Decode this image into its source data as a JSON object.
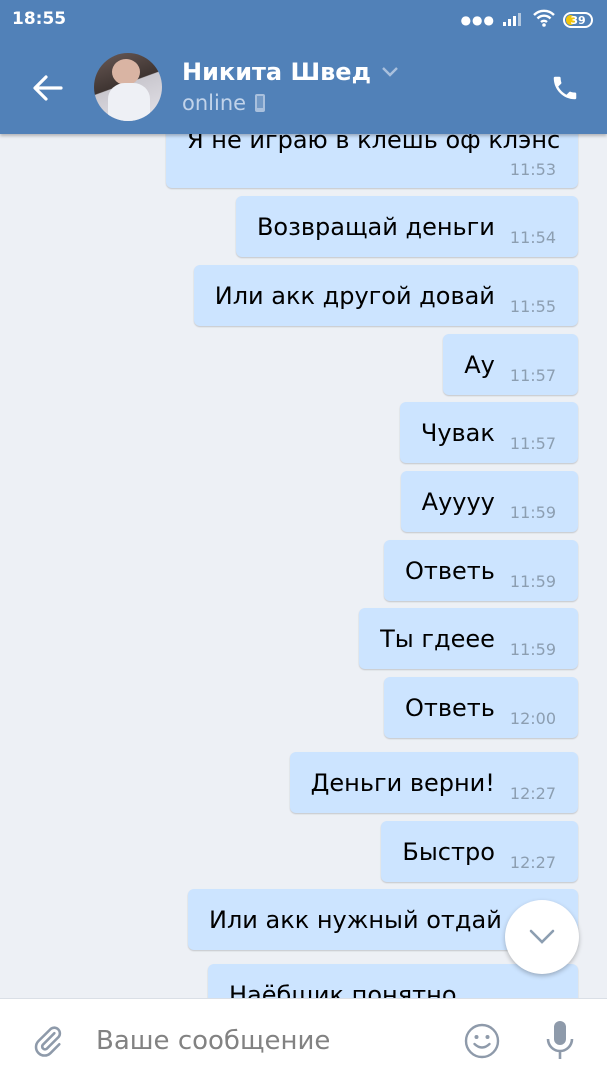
{
  "status_bar": {
    "time": "18:55",
    "battery_level": "39",
    "icons": [
      "dots-icon",
      "signal-icon",
      "wifi-icon",
      "battery-icon"
    ]
  },
  "header": {
    "contact_name": "Никита Швед",
    "presence": "online",
    "icons": [
      "back-arrow-icon",
      "avatar",
      "chevron-down-icon",
      "mobile-device-icon",
      "phone-icon"
    ]
  },
  "messages": [
    {
      "text": "Я не играю в клешь оф клэнс",
      "time": "11:53"
    },
    {
      "text": "Возвращай деньги",
      "time": "11:54"
    },
    {
      "text": "Или акк другой довай",
      "time": "11:55"
    },
    {
      "text": "Ау",
      "time": "11:57"
    },
    {
      "text": "Чувак",
      "time": "11:57"
    },
    {
      "text": "Ауууу",
      "time": "11:59"
    },
    {
      "text": "Ответь",
      "time": "11:59"
    },
    {
      "text": "Ты гдеее",
      "time": "11:59"
    },
    {
      "text": "Ответь",
      "time": "12:00"
    },
    {
      "text": "Деньги верни!",
      "time": "12:27"
    },
    {
      "text": "Быстро",
      "time": "12:27"
    },
    {
      "text": "Или акк нужный отдай",
      "time": ""
    },
    {
      "text": "Наёбщик понятно",
      "time": ""
    }
  ],
  "composer": {
    "placeholder": "Ваше сообщение",
    "icons": [
      "paperclip-icon",
      "emoji-icon",
      "microphone-icon"
    ]
  },
  "colors": {
    "header_bg": "#5181b8",
    "chat_bg": "#edf0f5",
    "outgoing_bubble": "#cce4ff",
    "timestamp": "#8c9eb1"
  }
}
